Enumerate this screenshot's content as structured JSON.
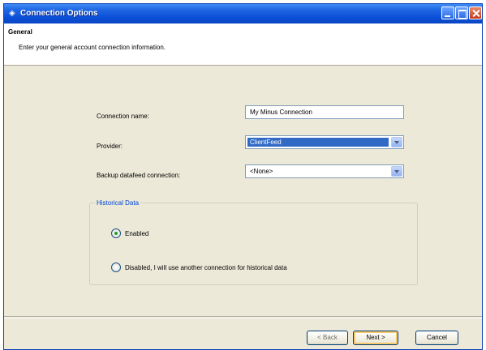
{
  "window": {
    "title": "Connection Options"
  },
  "header": {
    "title": "General",
    "subtitle": "Enter your general account connection information."
  },
  "form": {
    "connection_name_label": "Connection name:",
    "connection_name_value": "My Minus Connection",
    "provider_label": "Provider:",
    "provider_value": "ClientFeed",
    "backup_label": "Backup datafeed connection:",
    "backup_value": "<None>"
  },
  "historical": {
    "legend": "Historical Data",
    "enabled_label": "Enabled",
    "disabled_label": "Disabled, I will use another connection for historical data",
    "selected": "enabled"
  },
  "footer": {
    "back_label": "< Back",
    "next_label": "Next >",
    "cancel_label": "Cancel"
  },
  "colors": {
    "titlebar": "#0a4fd6",
    "selection": "#316ac5",
    "group_legend": "#0046d5",
    "dialog_face": "#ece9d8"
  },
  "icons": [
    "app-icon",
    "minimize-icon",
    "maximize-icon",
    "close-icon",
    "dropdown-arrow-icon",
    "radio-icon"
  ]
}
